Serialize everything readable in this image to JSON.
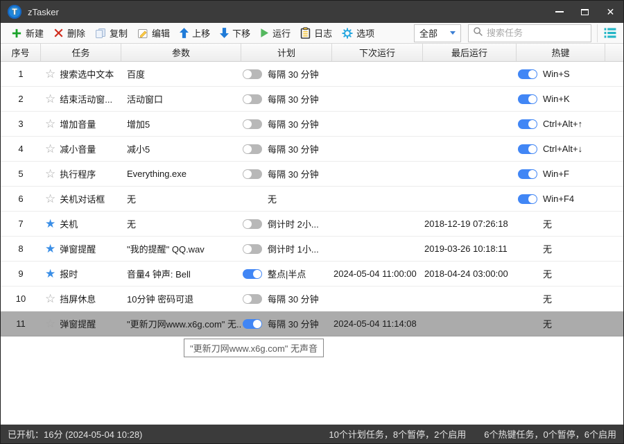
{
  "window": {
    "title": "zTasker"
  },
  "toolbar": {
    "buttons": [
      {
        "label": "新建"
      },
      {
        "label": "删除"
      },
      {
        "label": "复制"
      },
      {
        "label": "编辑"
      },
      {
        "label": "上移"
      },
      {
        "label": "下移"
      },
      {
        "label": "运行"
      },
      {
        "label": "日志"
      },
      {
        "label": "选项"
      }
    ],
    "filter": {
      "value": "全部"
    },
    "search": {
      "placeholder": "搜索任务"
    }
  },
  "table": {
    "headers": [
      "序号",
      "任务",
      "参数",
      "计划",
      "下次运行",
      "最后运行",
      "热键"
    ],
    "rows": [
      {
        "num": "1",
        "starred": false,
        "task": "搜索选中文本",
        "param": "百度",
        "schedule_toggle": "off",
        "schedule": "每隔 30 分钟",
        "next_run": "",
        "last_run": "",
        "hotkey_toggle": "on",
        "hotkey": "Win+S",
        "selected": false
      },
      {
        "num": "2",
        "starred": false,
        "task": "结束活动窗...",
        "param": "活动窗口",
        "schedule_toggle": "off",
        "schedule": "每隔 30 分钟",
        "next_run": "",
        "last_run": "",
        "hotkey_toggle": "on",
        "hotkey": "Win+K",
        "selected": false
      },
      {
        "num": "3",
        "starred": false,
        "task": "增加音量",
        "param": "增加5",
        "schedule_toggle": "off",
        "schedule": "每隔 30 分钟",
        "next_run": "",
        "last_run": "",
        "hotkey_toggle": "on",
        "hotkey": "Ctrl+Alt+↑",
        "selected": false
      },
      {
        "num": "4",
        "starred": false,
        "task": "减小音量",
        "param": "减小5",
        "schedule_toggle": "off",
        "schedule": "每隔 30 分钟",
        "next_run": "",
        "last_run": "",
        "hotkey_toggle": "on",
        "hotkey": "Ctrl+Alt+↓",
        "selected": false
      },
      {
        "num": "5",
        "starred": false,
        "task": "执行程序",
        "param": "Everything.exe",
        "schedule_toggle": "off",
        "schedule": "每隔 30 分钟",
        "next_run": "",
        "last_run": "",
        "hotkey_toggle": "on",
        "hotkey": "Win+F",
        "selected": false
      },
      {
        "num": "6",
        "starred": false,
        "task": "关机对话框",
        "param": "无",
        "schedule_toggle": "none",
        "schedule": "无",
        "next_run": "",
        "last_run": "",
        "hotkey_toggle": "on",
        "hotkey": "Win+F4",
        "selected": false
      },
      {
        "num": "7",
        "starred": true,
        "task": "关机",
        "param": "无",
        "schedule_toggle": "off",
        "schedule": "倒计时 2小...",
        "next_run": "",
        "last_run": "2018-12-19 07:26:18",
        "hotkey_toggle": "none",
        "hotkey": "无",
        "selected": false
      },
      {
        "num": "8",
        "starred": true,
        "task": "弹窗提醒",
        "param": "\"我的提醒\" QQ.wav",
        "schedule_toggle": "off",
        "schedule": "倒计时 1小...",
        "next_run": "",
        "last_run": "2019-03-26 10:18:11",
        "hotkey_toggle": "none",
        "hotkey": "无",
        "selected": false
      },
      {
        "num": "9",
        "starred": true,
        "task": "报时",
        "param": "音量4 钟声: Bell",
        "schedule_toggle": "on",
        "schedule": "整点|半点",
        "next_run": "2024-05-04 11:00:00",
        "last_run": "2018-04-24 03:00:00",
        "hotkey_toggle": "none",
        "hotkey": "无",
        "selected": false
      },
      {
        "num": "10",
        "starred": false,
        "task": "挡屏休息",
        "param": "10分钟 密码可退",
        "schedule_toggle": "off",
        "schedule": "每隔 30 分钟",
        "next_run": "",
        "last_run": "",
        "hotkey_toggle": "none",
        "hotkey": "无",
        "selected": false
      },
      {
        "num": "11",
        "starred": false,
        "task": "弹窗提醒",
        "param": "\"更新刀网www.x6g.com\" 无...",
        "schedule_toggle": "on",
        "schedule": "每隔 30 分钟",
        "next_run": "2024-05-04 11:14:08",
        "last_run": "",
        "hotkey_toggle": "none",
        "hotkey": "无",
        "selected": true
      }
    ]
  },
  "tooltip": {
    "text": "\"更新刀网www.x6g.com\" 无声音"
  },
  "statusbar": {
    "uptime": "已开机：16分 (2024-05-04 10:28)",
    "plan_summary": "10个计划任务，8个暂停，2个启用",
    "hotkey_summary": "6个热键任务，0个暂停，6个启用"
  },
  "colors": {
    "titlebar": "#3b3b3b",
    "accent_blue": "#4186f5",
    "star_blue": "#3a8ee6",
    "toggle_off": "#b8b8b8",
    "selected_row": "#ababab",
    "teal": "#24b6c6"
  }
}
